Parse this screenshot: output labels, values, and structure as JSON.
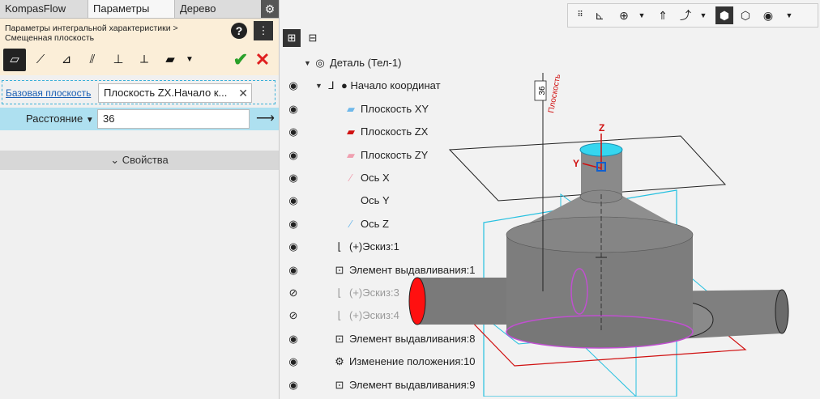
{
  "tabs": [
    "KompasFlow",
    "Параметры",
    "Дерево"
  ],
  "panel": {
    "breadcrumb_line1": "Параметры интегральной характеристики >",
    "breadcrumb_line2": "Смещенная плоскость",
    "help": "?",
    "base_plane_label": "Базовая плоскость",
    "base_plane_value": "Плоскость ZX.Начало к...",
    "distance_label": "Расстояние",
    "distance_value": "36",
    "properties_label": "Свойства"
  },
  "tree": [
    {
      "label": "Деталь (Тел-1)",
      "eye": false,
      "dim": false
    },
    {
      "label": "● Начало координат",
      "eye": true,
      "dim": false
    },
    {
      "label": "Плоскость XY",
      "eye": true,
      "dim": false
    },
    {
      "label": "Плоскость ZX",
      "eye": true,
      "dim": false
    },
    {
      "label": "Плоскость ZY",
      "eye": true,
      "dim": false
    },
    {
      "label": "Ось X",
      "eye": true,
      "dim": false
    },
    {
      "label": "Ось Y",
      "eye": true,
      "dim": false
    },
    {
      "label": "Ось Z",
      "eye": true,
      "dim": false
    },
    {
      "label": "(+)Эскиз:1",
      "eye": true,
      "dim": false
    },
    {
      "label": "Элемент выдавливания:1",
      "eye": true,
      "dim": false
    },
    {
      "label": "(+)Эскиз:3",
      "eye": "hidden",
      "dim": true
    },
    {
      "label": "(+)Эскиз:4",
      "eye": "hidden",
      "dim": true
    },
    {
      "label": "Элемент выдавливания:8",
      "eye": true,
      "dim": false
    },
    {
      "label": "Изменение положения:10",
      "eye": true,
      "dim": false
    },
    {
      "label": "Элемент выдавливания:9",
      "eye": true,
      "dim": false
    }
  ],
  "viewport": {
    "dim_label": "36",
    "plane_label": "Плоскость",
    "axis_z": "Z",
    "axis_y": "Y"
  },
  "colors": {
    "header_bg": "#fbeed8",
    "distance_row": "#aee0f0",
    "accent_blue": "#1a5fb4",
    "ok": "#2aa02a",
    "cancel": "#e02020"
  }
}
